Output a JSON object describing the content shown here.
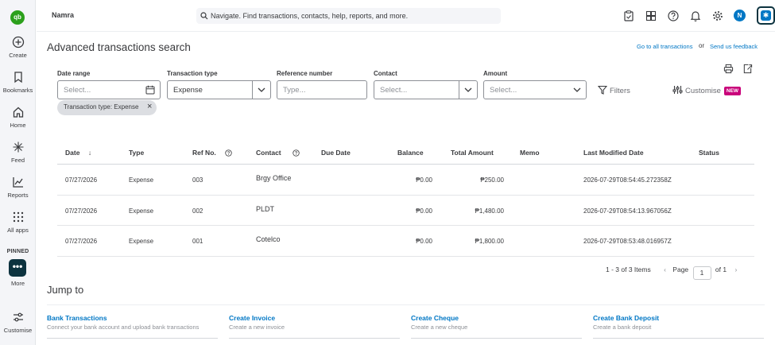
{
  "sidebar": {
    "logo_text": "qb",
    "items": [
      {
        "label": "Create",
        "icon": "plus-circle-icon"
      },
      {
        "label": "Bookmarks",
        "icon": "bookmark-icon"
      },
      {
        "label": "Home",
        "icon": "home-icon"
      },
      {
        "label": "Feed",
        "icon": "sparkle-icon"
      },
      {
        "label": "Reports",
        "icon": "chart-line-icon"
      },
      {
        "label": "All apps",
        "icon": "grid-icon"
      }
    ],
    "pinned_label": "PINNED",
    "more_label": "More",
    "customise_label": "Customise"
  },
  "topbar": {
    "company": "Namra",
    "search_text": "Navigate. Find transactions, contacts, help, reports, and more.",
    "avatar_initial": "N"
  },
  "page": {
    "title": "Advanced transactions search",
    "goto_all": "Go to all transactions",
    "or_text": "or",
    "feedback": "Send us feedback"
  },
  "filters": {
    "date_range": {
      "label": "Date range",
      "placeholder": "Select..."
    },
    "transaction_type": {
      "label": "Transaction type",
      "value": "Expense"
    },
    "reference_number": {
      "label": "Reference number",
      "placeholder": "Type..."
    },
    "contact": {
      "label": "Contact",
      "placeholder": "Select..."
    },
    "amount": {
      "label": "Amount",
      "placeholder": "Select..."
    },
    "filters_button": "Filters",
    "customise_button": "Customise",
    "new_badge": "NEW",
    "chip": "Transaction type: Expense"
  },
  "table": {
    "columns": {
      "date": "Date",
      "sort_arrow": "↓",
      "type": "Type",
      "ref": "Ref No.",
      "contact": "Contact",
      "due": "Due Date",
      "balance": "Balance",
      "total": "Total Amount",
      "memo": "Memo",
      "modified": "Last Modified Date",
      "status": "Status"
    },
    "rows": [
      {
        "date": "07/27/2026",
        "type": "Expense",
        "ref": "003",
        "contact": "Brgy Office",
        "due": "",
        "balance": "₱0.00",
        "total": "₱250.00",
        "memo": "",
        "modified": "2026-07-29T08:54:45.272358Z",
        "status": ""
      },
      {
        "date": "07/27/2026",
        "type": "Expense",
        "ref": "002",
        "contact": "PLDT",
        "due": "",
        "balance": "₱0.00",
        "total": "₱1,480.00",
        "memo": "",
        "modified": "2026-07-29T08:54:13.967056Z",
        "status": ""
      },
      {
        "date": "07/27/2026",
        "type": "Expense",
        "ref": "001",
        "contact": "Cotelco",
        "due": "",
        "balance": "₱0.00",
        "total": "₱1,800.00",
        "memo": "",
        "modified": "2026-07-29T08:53:48.016957Z",
        "status": ""
      }
    ]
  },
  "pagination": {
    "summary": "1 - 3 of 3 Items",
    "page_label": "Page",
    "page_value": "1",
    "of_label": "of 1"
  },
  "jump_to": {
    "title": "Jump to",
    "links": [
      {
        "title": "Bank Transactions",
        "desc": "Connect your bank account and upload bank transactions"
      },
      {
        "title": "Create Invoice",
        "desc": "Create a new invoice"
      },
      {
        "title": "Create Cheque",
        "desc": "Create a new cheque"
      },
      {
        "title": "Create Bank Deposit",
        "desc": "Create a bank deposit"
      }
    ]
  },
  "colors": {
    "accent": "#0077c5",
    "brand_green": "#2ca01c",
    "new_badge": "#c9007a",
    "dark_teal": "#0d333f"
  }
}
